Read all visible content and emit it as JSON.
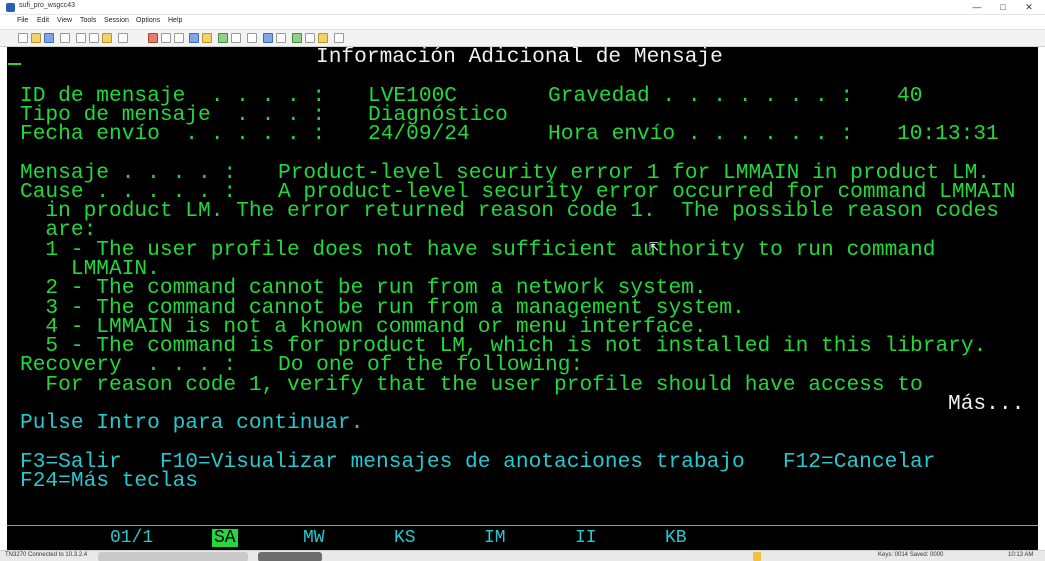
{
  "window": {
    "title": "sufi_pro_wsgcc43",
    "controls": {
      "minimize": "—",
      "maximize": "□",
      "close": "✕"
    }
  },
  "menu": [
    "File",
    "Edit",
    "View",
    "Tools",
    "Session",
    "Options",
    "Help"
  ],
  "toolbar_icons": [
    "new-icon",
    "open-icon",
    "save-icon",
    "print-icon",
    "cut-icon",
    "copy-icon",
    "paste-icon",
    "undo-icon",
    "redo-icon",
    "back-icon",
    "forward-icon",
    "refresh-icon",
    "home-icon",
    "macro-icon",
    "settings-icon",
    "help-icon"
  ],
  "screen": {
    "header": "Información Adicional de Mensaje",
    "fields": {
      "id_label": "ID de mensaje  . . . . :",
      "id_value": "LVE100C",
      "severity_label": "Gravedad . . . . . . . :",
      "severity_value": "40",
      "type_label": "Tipo de mensaje  . . . :",
      "type_value": "Diagnóstico",
      "date_label": "Fecha envío  . . . . . :",
      "date_value": "24/09/24",
      "time_label": "Hora envío . . . . . . :",
      "time_value": "10:13:31"
    },
    "message_label": "Mensaje . . . . :",
    "message_value": "Product-level security error 1 for LMMAIN in product LM.",
    "cause_label": "Cause . . . . . :",
    "cause_value": "A product-level security error occurred for command LMMAIN",
    "cause_lines": [
      "  in product LM. The error returned reason code 1.  The possible reason codes",
      "  are:",
      "  1 - The user profile does not have sufficient authority to run command",
      "    LMMAIN.",
      "  2 - The command cannot be run from a network system.",
      "  3 - The command cannot be run from a management system.",
      "  4 - LMMAIN is not a known command or menu interface.",
      "  5 - The command is for product LM, which is not installed in this library."
    ],
    "recovery_label": "Recovery  . . . :",
    "recovery_value": "Do one of the following:",
    "recovery_line": "  For reason code 1, verify that the user profile should have access to",
    "more": "Más...",
    "prompt": "Pulse Intro para continuar.",
    "fkeys_line1": "F3=Salir   F10=Visualizar mensajes de anotaciones trabajo   F12=Cancelar",
    "fkeys_line2": "F24=Más teclas"
  },
  "status_bar": {
    "page": "01/1",
    "sa": "SA",
    "mw": "MW",
    "ks": "KS",
    "im": "IM",
    "ii": "II",
    "kb": "KB"
  },
  "bottom_bar": {
    "connection": "TN3270 Connected to 10.3.2.4",
    "task1": "",
    "task2": "",
    "keys": "Keys: 0014   Saved: 0000",
    "clock": "10:13 AM"
  },
  "colors": {
    "background": "#000000",
    "green": "#22d83c",
    "cyan": "#26c9cf",
    "white": "#f0f0f0"
  }
}
